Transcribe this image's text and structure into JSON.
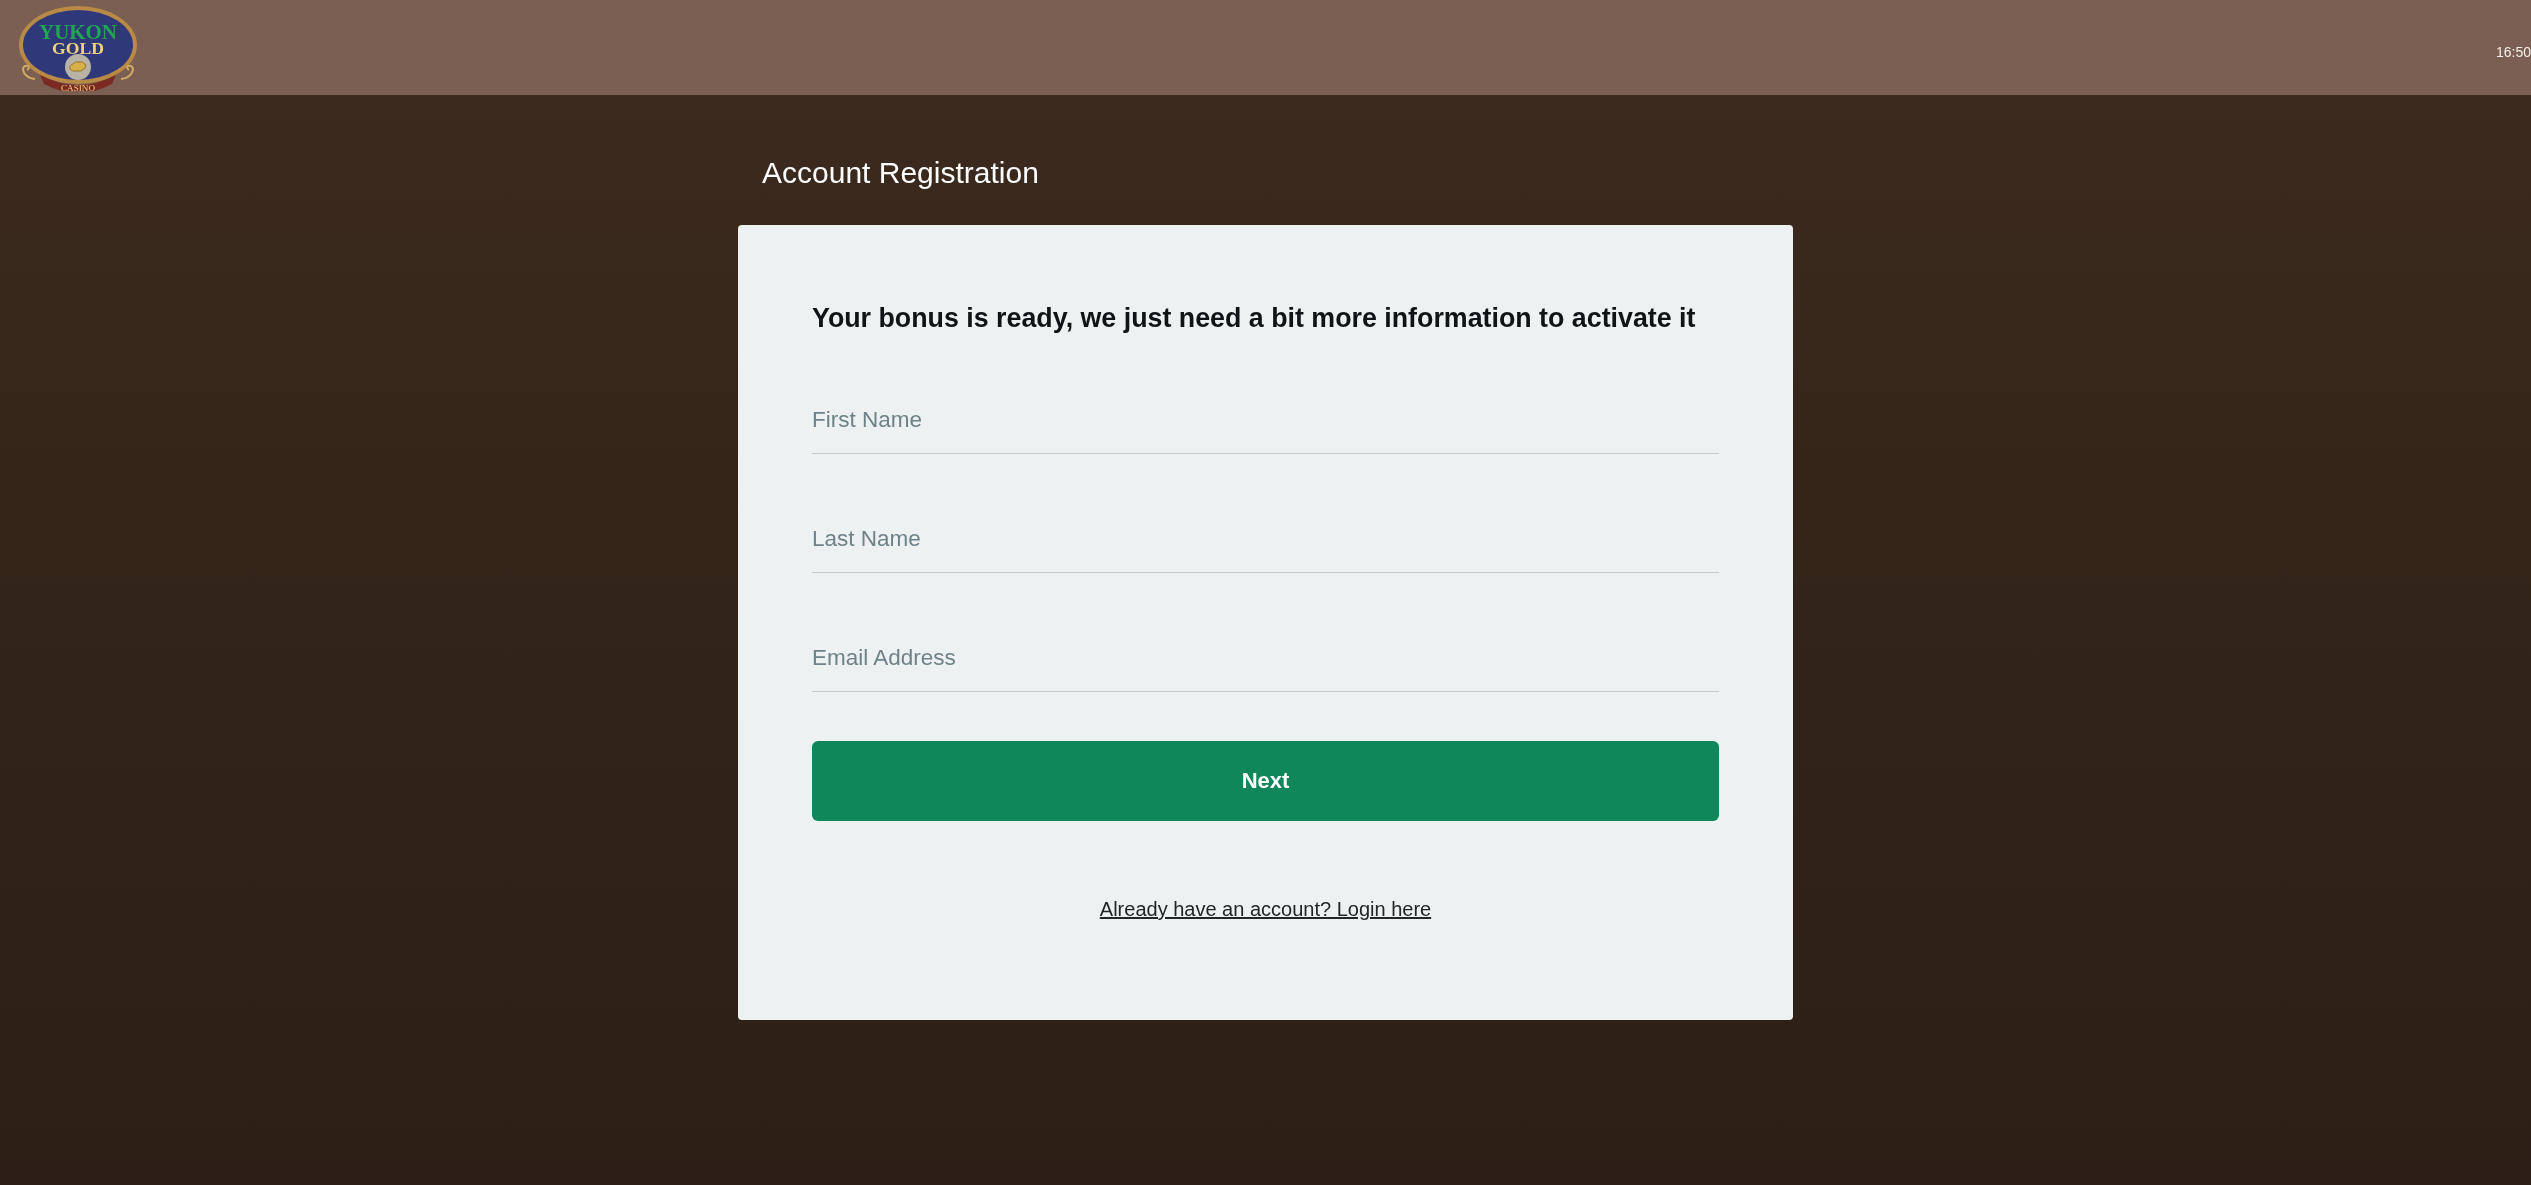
{
  "header": {
    "logo": {
      "line_1": "YUKON",
      "line_2": "GOLD",
      "line_3": "CASINO"
    },
    "time": "16:50"
  },
  "page": {
    "title": "Account Registration"
  },
  "form": {
    "heading": "Your bonus is ready, we just need a bit more information to activate it",
    "fields": [
      {
        "placeholder": "First Name"
      },
      {
        "placeholder": "Last Name"
      },
      {
        "placeholder": "Email Address"
      }
    ],
    "submit_button": "Next",
    "login_link": "Already have an account? Login here"
  }
}
